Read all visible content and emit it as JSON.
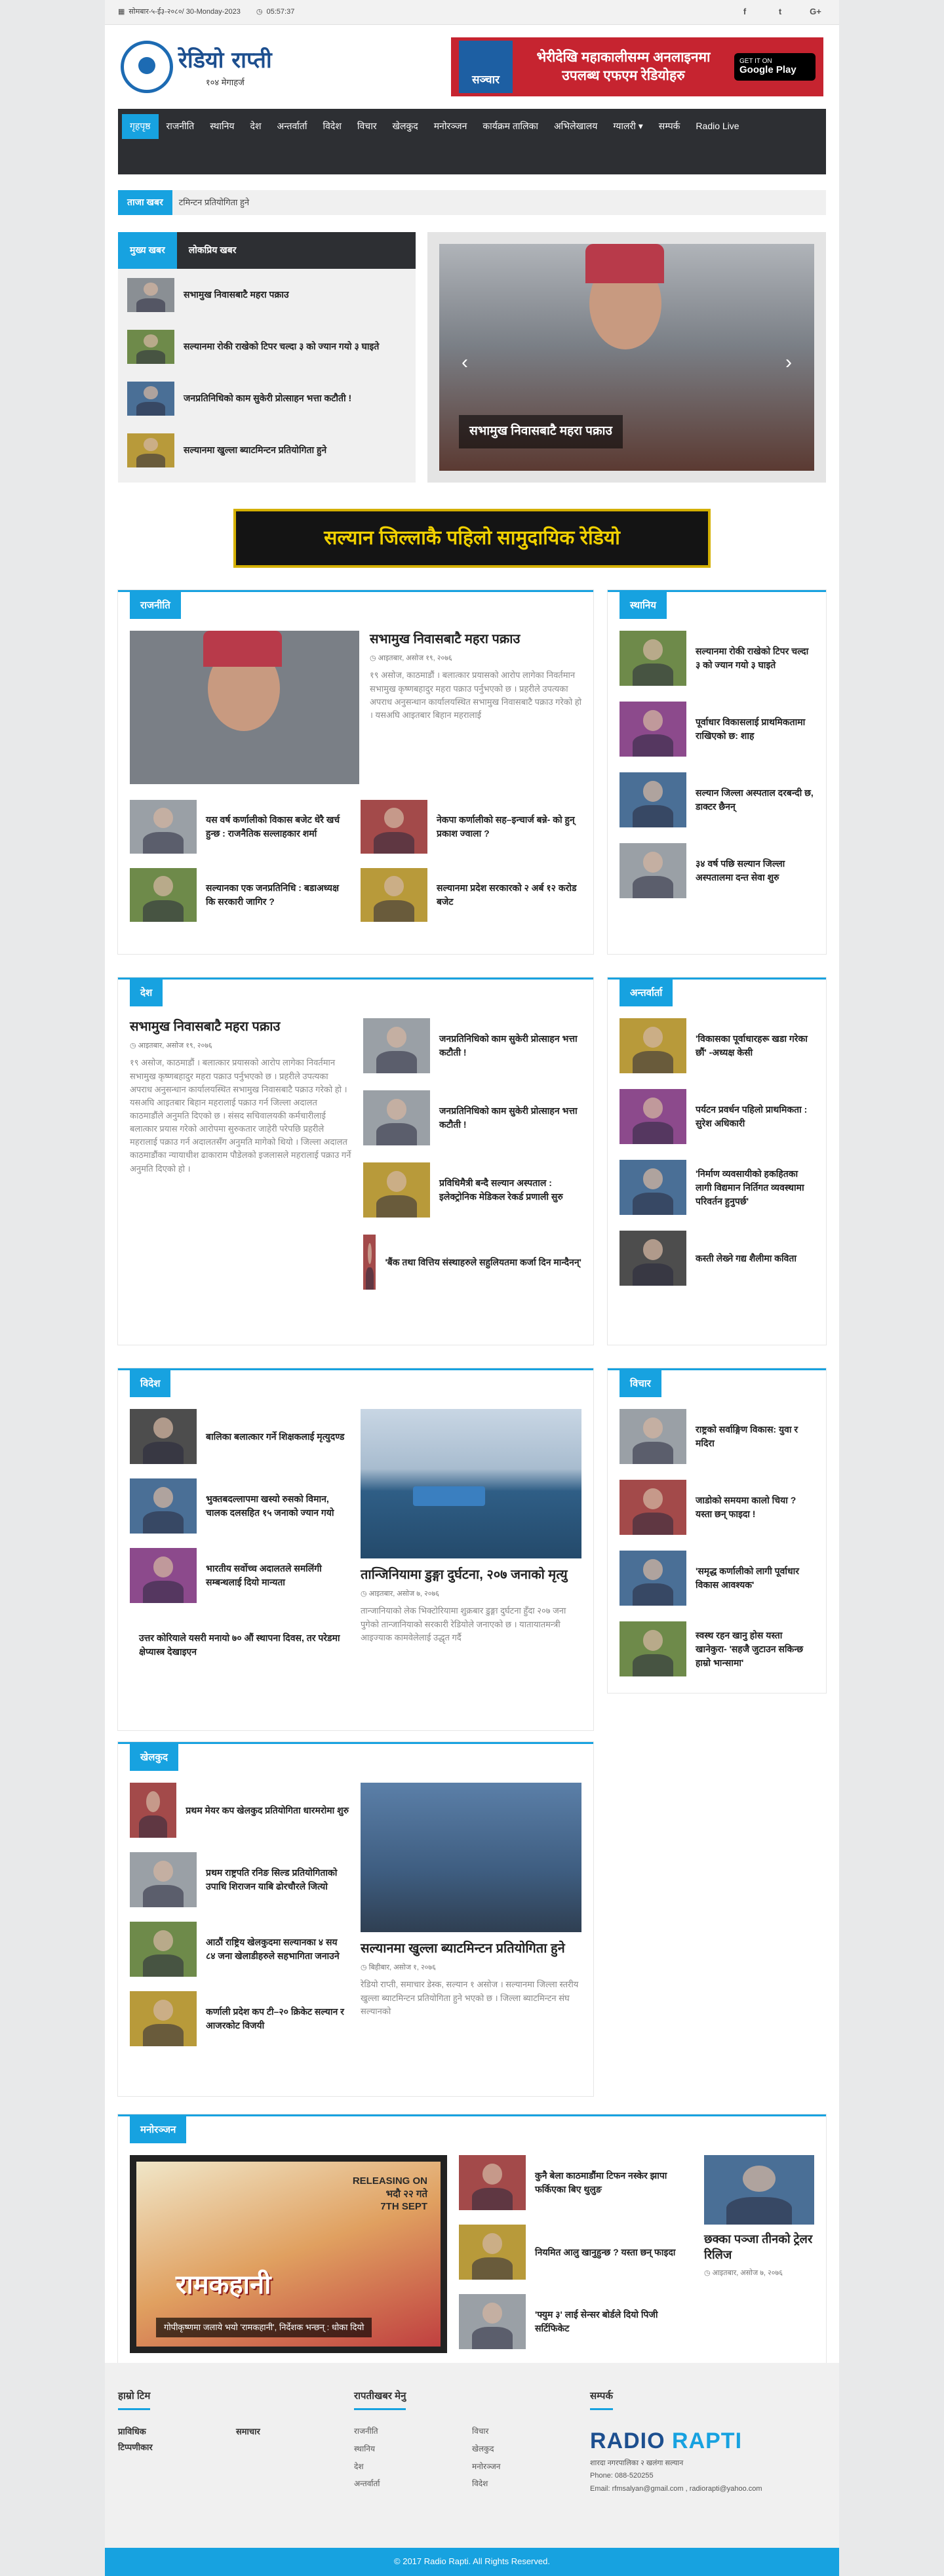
{
  "topbar": {
    "date": "सोमबार-५-ई३-२०८०/ 30-Monday-2023",
    "time": "05:57:37",
    "social": [
      "f",
      "t",
      "G+"
    ]
  },
  "logo": {
    "name": "रेडियो राप्ती",
    "freq": "१०४ मेगाहर्ज"
  },
  "banner": {
    "brand": "सञ्चार",
    "line1": "भेरीदेखि महाकालीसम्म अनलाइनमा",
    "line2": "उपलब्ध एफएम रेडियोहरु",
    "store_small": "GET IT ON",
    "store_big": "Google Play"
  },
  "nav": [
    "गृहपृष्ठ",
    "राजनीति",
    "स्थानिय",
    "देश",
    "अन्तर्वार्ता",
    "विदेश",
    "विचार",
    "खेलकुद",
    "मनोरञ्जन",
    "कार्यक्रम तालिका",
    "अभिलेखालय",
    "ग्यालरी ▾",
    "सम्पर्क",
    "Radio Live"
  ],
  "ticker": {
    "label": "ताजा खबर",
    "text": "टमिन्टन प्रतियोगिता हुने"
  },
  "tabs": {
    "labels": [
      "मुख्य खबर",
      "लोकप्रिय खबर"
    ],
    "items": [
      "सभामुख निवासबाटै महरा पक्राउ",
      "सल्यानमा रोकी राखेको टिपर चल्दा ३ को ज्यान गयो ३ घाइते",
      "जनप्रतिनिधिको काम सुकेरी प्रोत्साहन भत्ता कटौती !",
      "सल्यानमा खुल्ला ब्याटमिन्टन प्रतियोगिता हुने"
    ]
  },
  "slider": {
    "caption": "सभामुख निवासबाटै महरा पक्राउ"
  },
  "ad": {
    "text": "सल्यान जिल्लाकै पहिलो सामुदायिक रेडियो"
  },
  "rajniti": {
    "title": "राजनीति",
    "headline": "सभामुख निवासबाटै महरा पक्राउ",
    "meta": "आइतबार, असोज १९, २०७६",
    "excerpt": "१९ असोज, काठमाडौं । बलात्कार प्रयासको आरोप लागेका निवर्तमान सभामुख कृष्णबहादुर महरा पक्राउ पर्नुभएको छ । प्रहरीले उपत्यका अपराध अनुसन्धान कार्यालयस्थित सभामुख निवासबाटै पक्राउ गरेको हो । यसअघि आइतबार बिहान महरालाई",
    "items": [
      "यस वर्ष कर्णालीको विकास बजेट धेरै खर्च हुन्छ : राजनैतिक सल्लाहकार शर्मा",
      "नेकपा कर्णालीको सह–इन्चार्ज बन्ने- को हुन् प्रकाश ज्वाला ?",
      "सल्यानका एक जनप्रतिनिधि : बडाअध्यक्ष कि सरकारी जागिर ?",
      "सल्यानमा प्रदेश सरकारको २ अर्ब १२ करोड बजेट"
    ]
  },
  "sthaniya": {
    "title": "स्थानिय",
    "items": [
      "सल्यानमा रोकी राखेको टिपर चल्दा ३ को ज्यान गयो ३ घाइते",
      "पूर्वाधार विकासलाई प्राथमिकतामा राखिएको छ: शाह",
      "सल्यान जिल्ला अस्पताल दरबन्दी छ, डाक्टर छैनन्",
      "३४ वर्ष पछि सल्यान जिल्ला अस्पतालमा दन्त सेवा शुरु"
    ]
  },
  "desh": {
    "title": "देश",
    "headline": "सभामुख निवासबाटै महरा पक्राउ",
    "meta": "आइतबार, असोज १९, २०७६",
    "excerpt": "१९ असोज, काठमाडौं । बलात्कार प्रयासको आरोप लागेका निवर्तमान सभामुख कृष्णबहादुर महरा पक्राउ पर्नुभएको छ । प्रहरीले उपत्यका अपराध अनुसन्धान कार्यालयस्थित सभामुख निवासबाटै पक्राउ गरेको हो । यसअघि आइतबार बिहान महरालाई पक्राउ गर्न जिल्ला अदालत काठमाडौंले अनुमति दिएको छ । संसद सचिवालयकी कर्मचारीलाई बलात्कार प्रयास गरेको आरोपमा सुरुकतार जाहेरी परेपछि प्रहरीले महरालाई पक्राउ गर्न अदालतसँग अनुमति मागेको थियो । जिल्ला अदालत काठमाडौंका न्यायाधीश ढाकाराम पौडेलको इजलासले महरालाई पक्राउ गर्ने अनुमति दिएको हो ।",
    "items": [
      "जनप्रतिनिधिको काम सुकेरी प्रोत्साहन भत्ता कटौती !",
      "जनप्रतिनिधिको काम सुकेरी प्रोत्साहन भत्ता कटौती !",
      "प्रविधिमैत्री बन्दै सल्यान अस्पताल : इलेक्ट्रोनिक मेडिकल रेकर्ड प्रणाली सुरु",
      "'बैंक तथा वित्तिय संस्थाहरुले सहुलियतमा कर्जा दिन मान्दैनन्'"
    ]
  },
  "antarbarta": {
    "title": "अन्तर्वार्ता",
    "items": [
      "'विकासका पूर्वाधारहरू खडा गरेका छौं' -अध्यक्ष केसी",
      "पर्यटन प्रवर्धन पहिलो प्राथमिकता : सुरेश अधिकारी",
      "'निर्माण व्यवसायीको हकहितका लागी विद्यमान निर्तिगत व्यवस्थामा परिवर्तन हुनुपर्छ'",
      "कस्ती लेख्ने गद्य शैलीमा कविता"
    ]
  },
  "bidesh": {
    "title": "विदेश",
    "headline": "तान्जिनियामा डुङ्गा दुर्घटना, २०७ जनाको मृत्यु",
    "meta": "आइतबार, असोज ७, २०७६",
    "excerpt": "तान्जानियाको लेक भिक्टोरियामा शुक्रबार डुङ्गा दुर्घटना हुँदा २०७ जना पुगेको तान्जानियाको सरकारी रेडियोले जनाएको छ । यातायातमन्त्री आइज्याक कामवेलेलाई उद्धृत गर्दै",
    "items": [
      "बालिका बलात्कार गर्ने शिक्षकलाई मृत्युदण्ड",
      "भुक्तबदल्लापमा खस्यो रुसको विमान, चालक दलसहित १५ जनाको ज्यान गयो",
      "भारतीय सर्वोच्च अदालतले समलिंगी सम्बन्धलाई दियो मान्यता",
      "उत्तर कोरियाले यसरी मनायो ७० औं स्थापना दिवस, तर परेडमा क्षेप्यास्त्र देखाइएन"
    ]
  },
  "bichar": {
    "title": "विचार",
    "items": [
      "राष्ट्रको सर्वाङ्गिण विकास: युवा र मदिरा",
      "जाडोको समयमा कालो चिया ? यस्ता छन् फाइदा !",
      "'समृद्ध कर्णालीको लागी पूर्वाधार विकास आवश्यक'",
      "स्वस्थ रहन खानु होस यस्ता खानेकुरा- 'सहजै जुटाउन सकिन्छ हाम्रो भान्सामा'"
    ]
  },
  "khelkud": {
    "title": "खेलकुद",
    "headline": "सल्यानमा खुल्ला ब्याटमिन्टन प्रतियोगिता हुने",
    "meta": "बिहीबार, असोज १, २०७६",
    "excerpt": "रेडियो राप्ती, समाचार डेस्क, सल्यान १ असोज । सल्यानमा जिल्ला स्तरीय खुल्ला ब्याटमिन्टन प्रतियोगिता हुने भएको छ । जिल्ला ब्याटमिन्टन संघ सल्यानको",
    "items": [
      "प्रथम मेयर कप खेलकुद प्रतियोगिता धारमरोमा शुरु",
      "प्रथम राष्ट्रपति रनिङ सिल्ड प्रतियोगिताको उपाधि शिराजन याबि ढोरचौरले जित्यो",
      "आठौं राष्ट्रिय खेलकुदमा सल्यानका ४ सय ८४ जना खेलाडीहरुले सहभागिता जनाउने",
      "कर्णाली प्रदेश कप टी–२० क्रिकेट सल्यान र आजरकोट विजयी"
    ]
  },
  "manoranjan": {
    "title": "मनोरञ्जन",
    "poster_title": "रामकहानी",
    "poster_release": "RELEASING ON\nभदौ २२ गते\n7TH SEPT",
    "poster_caption": "गोपीकृष्णमा जलाये भयो 'रामकहानी', निर्देशक भन्छन् : धोका दियो",
    "items": [
      "कुनै बेला काठमाडौंमा टिफन नस्केर झापा फर्किएका बिए थुलुङ",
      "नियमित आलु खानुहुन्छ ? यस्ता छन् फाइदा",
      "'फ्युम ३' लाई सेन्सर बोर्डले दियो पिजी सर्टिफिकेट"
    ],
    "right_headline": "छक्का पञ्जा तीनको ट्रेलर रिलिज",
    "right_meta": "आइतबार, असोज ७, २०७६"
  },
  "footer": {
    "col1_title": "हाम्रो टिम",
    "col1_links": [
      "प्राविधिक",
      "समाचार",
      "टिप्पणीकार"
    ],
    "col2_title": "रापतीखबर मेनु",
    "col2_links": [
      "राजनीति",
      "विचार",
      "स्थानिय",
      "खेलकुद",
      "देश",
      "मनोरञ्जन",
      "अन्तर्वार्ता",
      "विदेश"
    ],
    "col3_title": "सम्पर्क",
    "brand1": "RADIO",
    "brand2": "RAPTI",
    "address": "शारदा नगरपालिका २ खलंगा सल्यान",
    "phone": "Phone: 088-520255",
    "email": "Email: rfmsalyan@gmail.com , radiorapti@yahoo.com"
  },
  "copyright": "© 2017 Radio Rapti. All Rights Reserved.",
  "colors": {
    "accent": "#17a2e0",
    "nav": "#2d2f33",
    "brand": "#1d4f8f"
  }
}
